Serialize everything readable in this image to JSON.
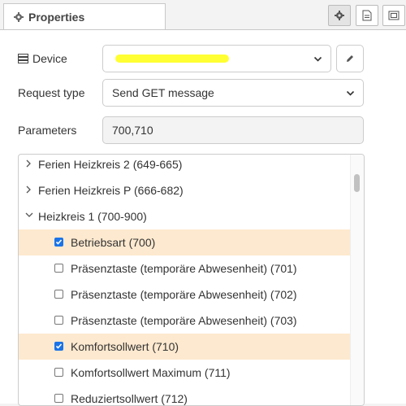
{
  "tab": {
    "title": "Properties"
  },
  "fields": {
    "device_label": "Device",
    "request_label": "Request type",
    "request_value": "Send GET message",
    "params_label": "Parameters",
    "params_value": "700,710"
  },
  "tree": {
    "items": [
      {
        "label": "Ferien Heizkreis 2 (649-665)",
        "type": "group",
        "expanded": false
      },
      {
        "label": "Ferien Heizkreis P (666-682)",
        "type": "group",
        "expanded": false
      },
      {
        "label": "Heizkreis 1 (700-900)",
        "type": "group",
        "expanded": true
      },
      {
        "label": "Betriebsart (700)",
        "type": "leaf",
        "checked": true
      },
      {
        "label": "Präsenztaste (temporäre Abwesenheit) (701)",
        "type": "leaf",
        "checked": false
      },
      {
        "label": "Präsenztaste (temporäre Abwesenheit) (702)",
        "type": "leaf",
        "checked": false
      },
      {
        "label": "Präsenztaste (temporäre Abwesenheit) (703)",
        "type": "leaf",
        "checked": false
      },
      {
        "label": "Komfortsollwert (710)",
        "type": "leaf",
        "checked": true
      },
      {
        "label": "Komfortsollwert Maximum (711)",
        "type": "leaf",
        "checked": false
      },
      {
        "label": "Reduziertsollwert (712)",
        "type": "leaf",
        "checked": false
      }
    ]
  },
  "colors": {
    "highlight": "#fde9cf",
    "redaction": "#ffff33",
    "checkbox": "#1a73e8"
  }
}
